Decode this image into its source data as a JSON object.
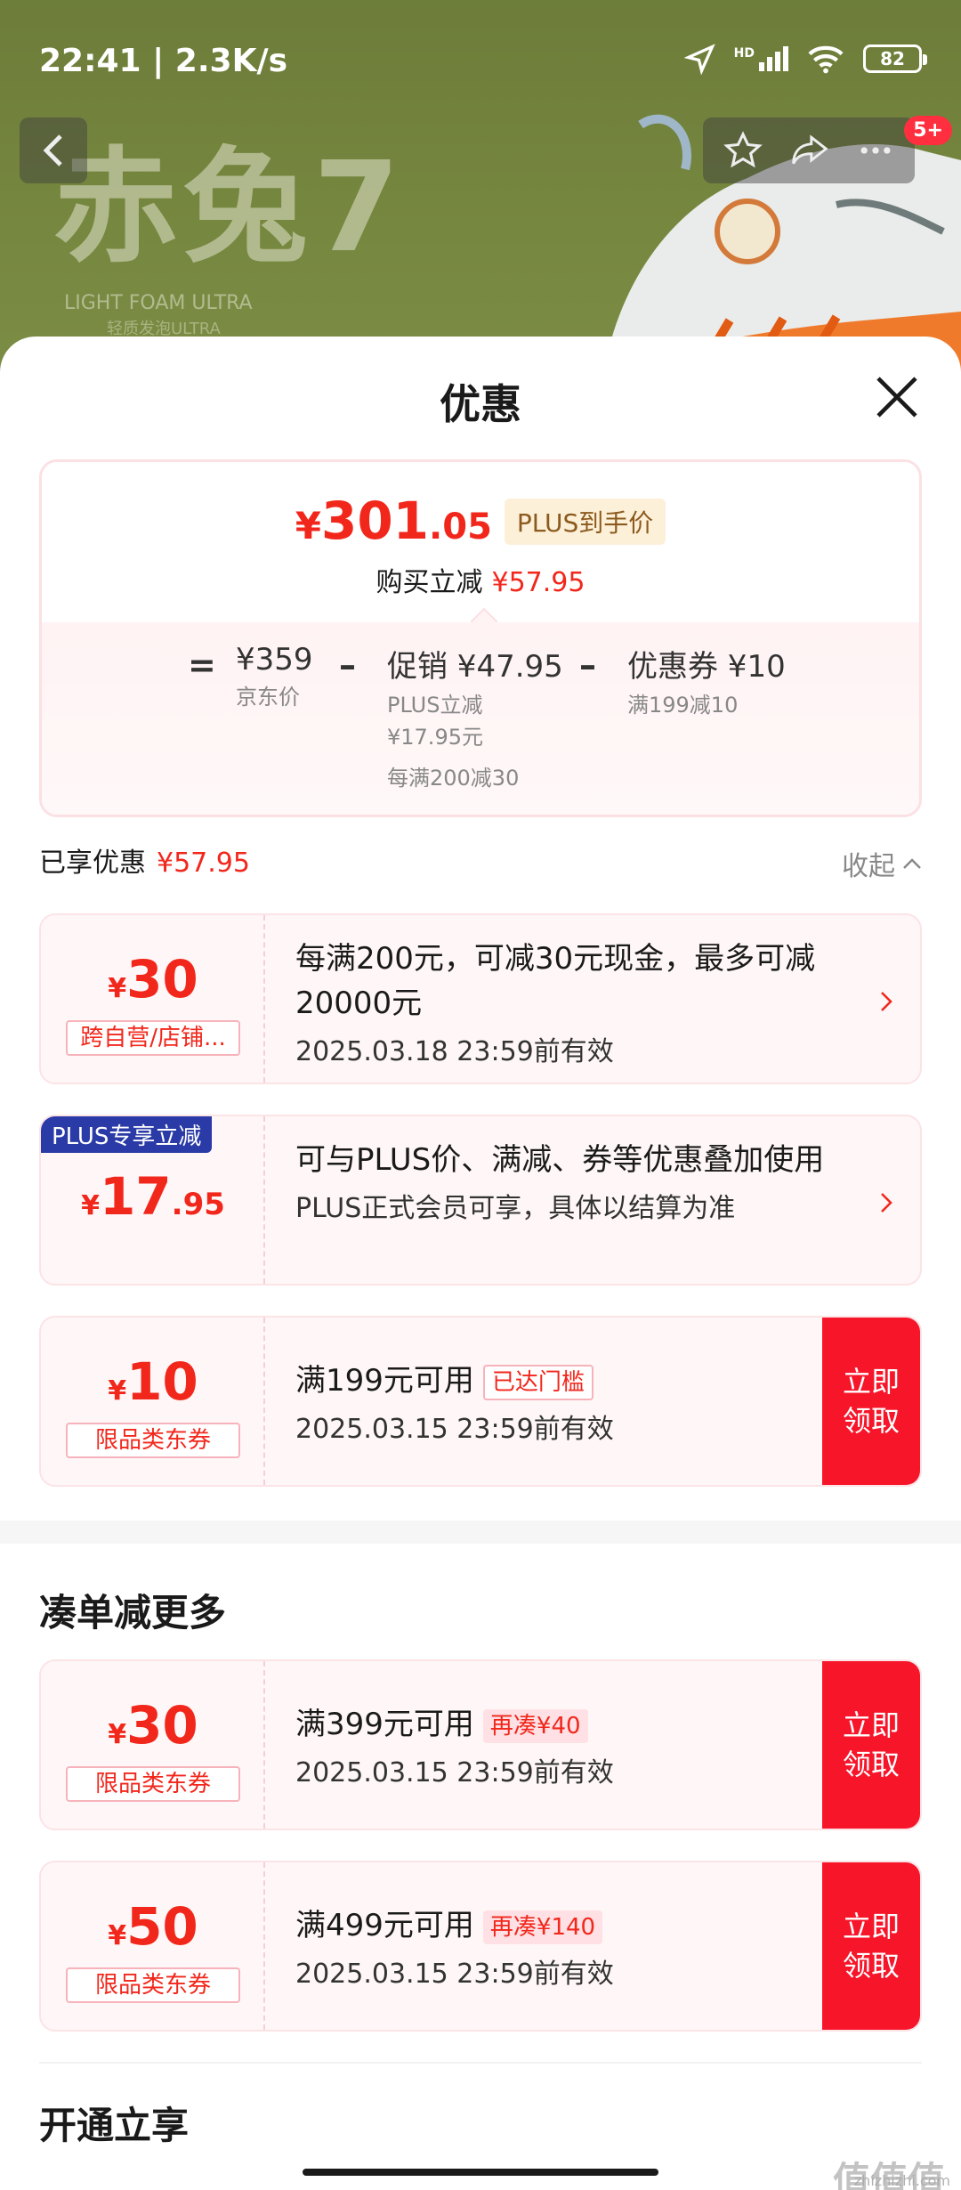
{
  "status_bar": {
    "time": "22:41 | 2.3K/s",
    "battery": "82",
    "network": "HD"
  },
  "hero": {
    "title": "赤兔7",
    "sub": "LIGHT FOAM ULTRA",
    "sub2": "轻质发泡ULTRA"
  },
  "nav": {
    "message_badge": "5+"
  },
  "sheet": {
    "title": "优惠"
  },
  "summary": {
    "final_yen": "¥",
    "final_int": "301",
    "final_dec": ".05",
    "plus_label": "PLUS到手价",
    "discount_label": "购买立减",
    "discount_value": "¥57.95",
    "eq": "=",
    "jd_price": "¥359",
    "jd_label": "京东价",
    "minus1": "–",
    "promo_value": "促销 ¥47.95",
    "promo_line1": "PLUS立减",
    "promo_line2": "¥17.95元",
    "promo_line3": "每满200减30",
    "minus2": "–",
    "coupon_value": "优惠券 ¥10",
    "coupon_label": "满199减10"
  },
  "applied": {
    "label": "已享优惠",
    "value": "¥57.95",
    "collapse": "收起"
  },
  "cards": [
    {
      "yen": "¥",
      "amount": "30",
      "tag": "跨自营/店铺...",
      "main": "每满200元，可减30元现金，最多可减20000元",
      "sub": "2025.03.18 23:59前有效"
    },
    {
      "badge": "PLUS专享立减",
      "yen": "¥",
      "amount": "17",
      "dec": ".95",
      "main": "可与PLUS价、满减、券等优惠叠加使用",
      "sub": "PLUS正式会员可享，具体以结算为准"
    },
    {
      "yen": "¥",
      "amount": "10",
      "tag": "限品类东券",
      "main": "满199元可用",
      "status": "已达门槛",
      "sub": "2025.03.15 23:59前有效",
      "claim": "立即领取"
    }
  ],
  "more_section": {
    "title": "凑单减更多",
    "cards": [
      {
        "yen": "¥",
        "amount": "30",
        "tag": "限品类东券",
        "main": "满399元可用",
        "more": "再凑¥40",
        "sub": "2025.03.15 23:59前有效",
        "claim": "立即领取"
      },
      {
        "yen": "¥",
        "amount": "50",
        "tag": "限品类东券",
        "main": "满499元可用",
        "more": "再凑¥140",
        "sub": "2025.03.15 23:59前有效",
        "claim": "立即领取"
      }
    ]
  },
  "open_section": {
    "title": "开通立享"
  },
  "watermark": {
    "text": "值值值",
    "sub": "zhizhizhi.com"
  },
  "colors": {
    "accent_red": "#f2271c",
    "claim_red": "#f7152a",
    "plus_blue": "#2a3aa6"
  }
}
